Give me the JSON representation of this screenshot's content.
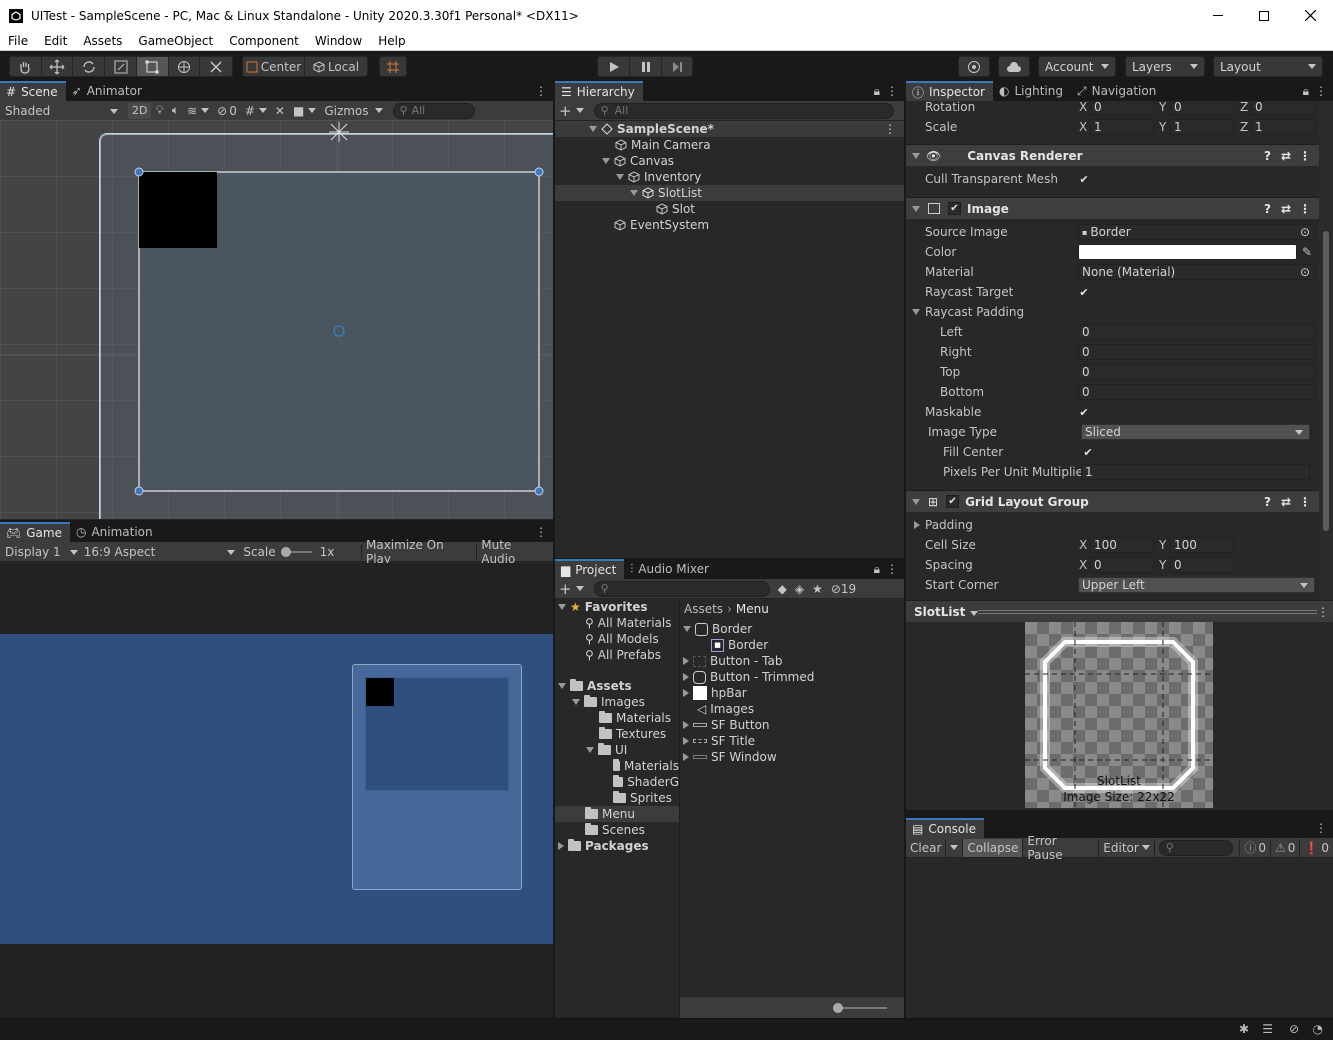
{
  "window": {
    "title": "UITest - SampleScene - PC, Mac & Linux Standalone - Unity 2020.3.30f1 Personal* <DX11>"
  },
  "menu": [
    "File",
    "Edit",
    "Assets",
    "GameObject",
    "Component",
    "Window",
    "Help"
  ],
  "toolbar": {
    "pivot_center": "Center",
    "pivot_local": "Local",
    "account": "Account",
    "layers": "Layers",
    "layout": "Layout"
  },
  "scene_panel": {
    "tabs": [
      "Scene",
      "Animator"
    ],
    "shading": "Shaded",
    "mode_2d": "2D",
    "hidden_count": "0",
    "gizmos": "Gizmos",
    "search_placeholder": "All"
  },
  "game_panel": {
    "tabs": [
      "Game",
      "Animation"
    ],
    "display": "Display 1",
    "aspect": "16:9 Aspect",
    "scale_label": "Scale",
    "scale_value": "1x",
    "maximize": "Maximize On Play",
    "mute": "Mute Audio"
  },
  "hierarchy": {
    "tab": "Hierarchy",
    "search_placeholder": "All",
    "items": [
      {
        "label": "SampleScene*"
      },
      {
        "label": "Main Camera"
      },
      {
        "label": "Canvas"
      },
      {
        "label": "Inventory"
      },
      {
        "label": "SlotList"
      },
      {
        "label": "Slot"
      },
      {
        "label": "EventSystem"
      }
    ]
  },
  "inspector": {
    "tabs": [
      "Inspector",
      "Lighting",
      "Navigation"
    ],
    "transform": {
      "rotation_label": "Rotation",
      "rotation": {
        "x": "0",
        "y": "0",
        "z": "0"
      },
      "scale_label": "Scale",
      "scale": {
        "x": "1",
        "y": "1",
        "z": "1"
      }
    },
    "canvas_renderer": {
      "title": "Canvas Renderer",
      "cull_label": "Cull Transparent Mesh"
    },
    "image": {
      "title": "Image",
      "source_image_label": "Source Image",
      "source_image": "Border",
      "color_label": "Color",
      "material_label": "Material",
      "material": "None (Material)",
      "raycast_target_label": "Raycast Target",
      "raycast_padding_label": "Raycast Padding",
      "left_label": "Left",
      "left": "0",
      "right_label": "Right",
      "right": "0",
      "top_label": "Top",
      "top": "0",
      "bottom_label": "Bottom",
      "bottom": "0",
      "maskable_label": "Maskable",
      "image_type_label": "Image Type",
      "image_type": "Sliced",
      "fill_center_label": "Fill Center",
      "ppu_label": "Pixels Per Unit Multiplier",
      "ppu": "1"
    },
    "grid_layout": {
      "title": "Grid Layout Group",
      "padding_label": "Padding",
      "cell_size_label": "Cell Size",
      "cell_x": "100",
      "cell_y": "100",
      "spacing_label": "Spacing",
      "spacing_x": "0",
      "spacing_y": "0",
      "start_corner_label": "Start Corner",
      "start_corner": "Upper Left"
    },
    "preview": {
      "object": "SlotList",
      "name": "SlotList",
      "size": "Image Size: 22x22"
    }
  },
  "project": {
    "tabs": [
      "Project",
      "Audio Mixer"
    ],
    "hidden_count": "19",
    "favorites": {
      "label": "Favorites",
      "items": [
        "All Materials",
        "All Models",
        "All Prefabs"
      ]
    },
    "tree": [
      {
        "label": "Assets"
      },
      {
        "label": "Images"
      },
      {
        "label": "Materials"
      },
      {
        "label": "Textures"
      },
      {
        "label": "UI"
      },
      {
        "label": "Materials"
      },
      {
        "label": "ShaderG"
      },
      {
        "label": "Sprites"
      },
      {
        "label": "Menu"
      },
      {
        "label": "Scenes"
      },
      {
        "label": "Packages"
      }
    ],
    "breadcrumb": [
      "Assets",
      "Menu"
    ],
    "files": [
      "Border",
      "Border",
      "Button - Tab",
      "Button - Trimmed",
      "hpBar",
      "Images",
      "SF Button",
      "SF Title",
      "SF Window"
    ]
  },
  "console": {
    "tab": "Console",
    "clear": "Clear",
    "collapse": "Collapse",
    "error_pause": "Error Pause",
    "editor": "Editor",
    "logs": "0",
    "warnings": "0",
    "errors": "0"
  },
  "colors": {
    "accent": "#3a79bb",
    "selection": "#46607c",
    "game_bg": "#2f4f7e"
  }
}
